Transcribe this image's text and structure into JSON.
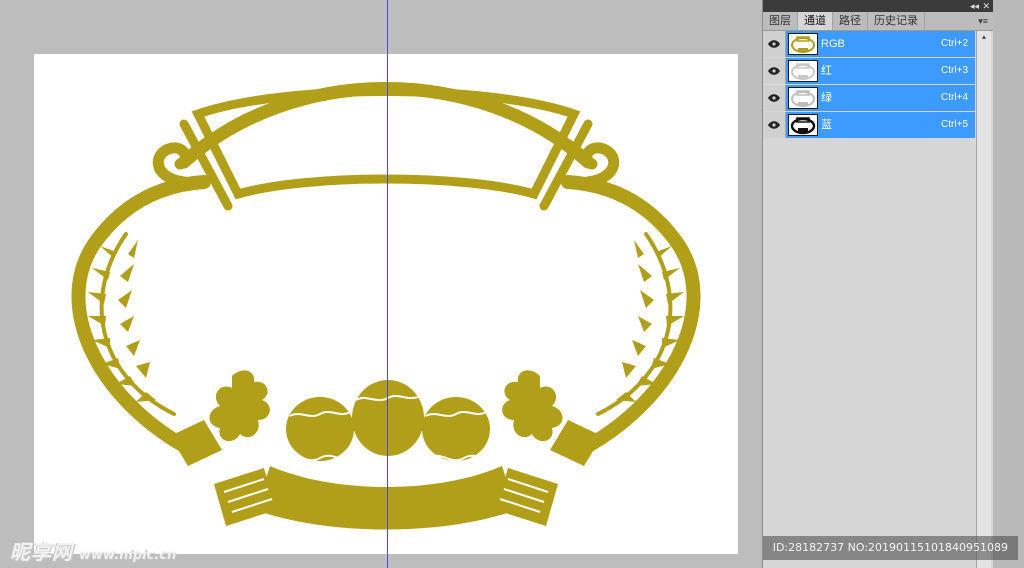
{
  "panel": {
    "tabs": [
      {
        "label": "图层",
        "active": false
      },
      {
        "label": "通道",
        "active": true
      },
      {
        "label": "路径",
        "active": false
      },
      {
        "label": "历史记录",
        "active": false
      }
    ],
    "collapse_icon": "double-chevron-right-icon",
    "menu_icon": "panel-menu-icon",
    "channels": [
      {
        "name": "RGB",
        "shortcut": "Ctrl+2",
        "thumb": "color"
      },
      {
        "name": "红",
        "shortcut": "Ctrl+3",
        "thumb": "light"
      },
      {
        "name": "绿",
        "shortcut": "Ctrl+4",
        "thumb": "light"
      },
      {
        "name": "蓝",
        "shortcut": "Ctrl+5",
        "thumb": "dark"
      }
    ]
  },
  "watermark": {
    "logo": "昵享网",
    "url": "www.nipic.cn",
    "id_text": "ID:28182737 NO:20190115101840951089"
  },
  "colors": {
    "emblem": "#b19f1a",
    "selection": "#3d9bff",
    "guide": "#4b4bd8"
  }
}
